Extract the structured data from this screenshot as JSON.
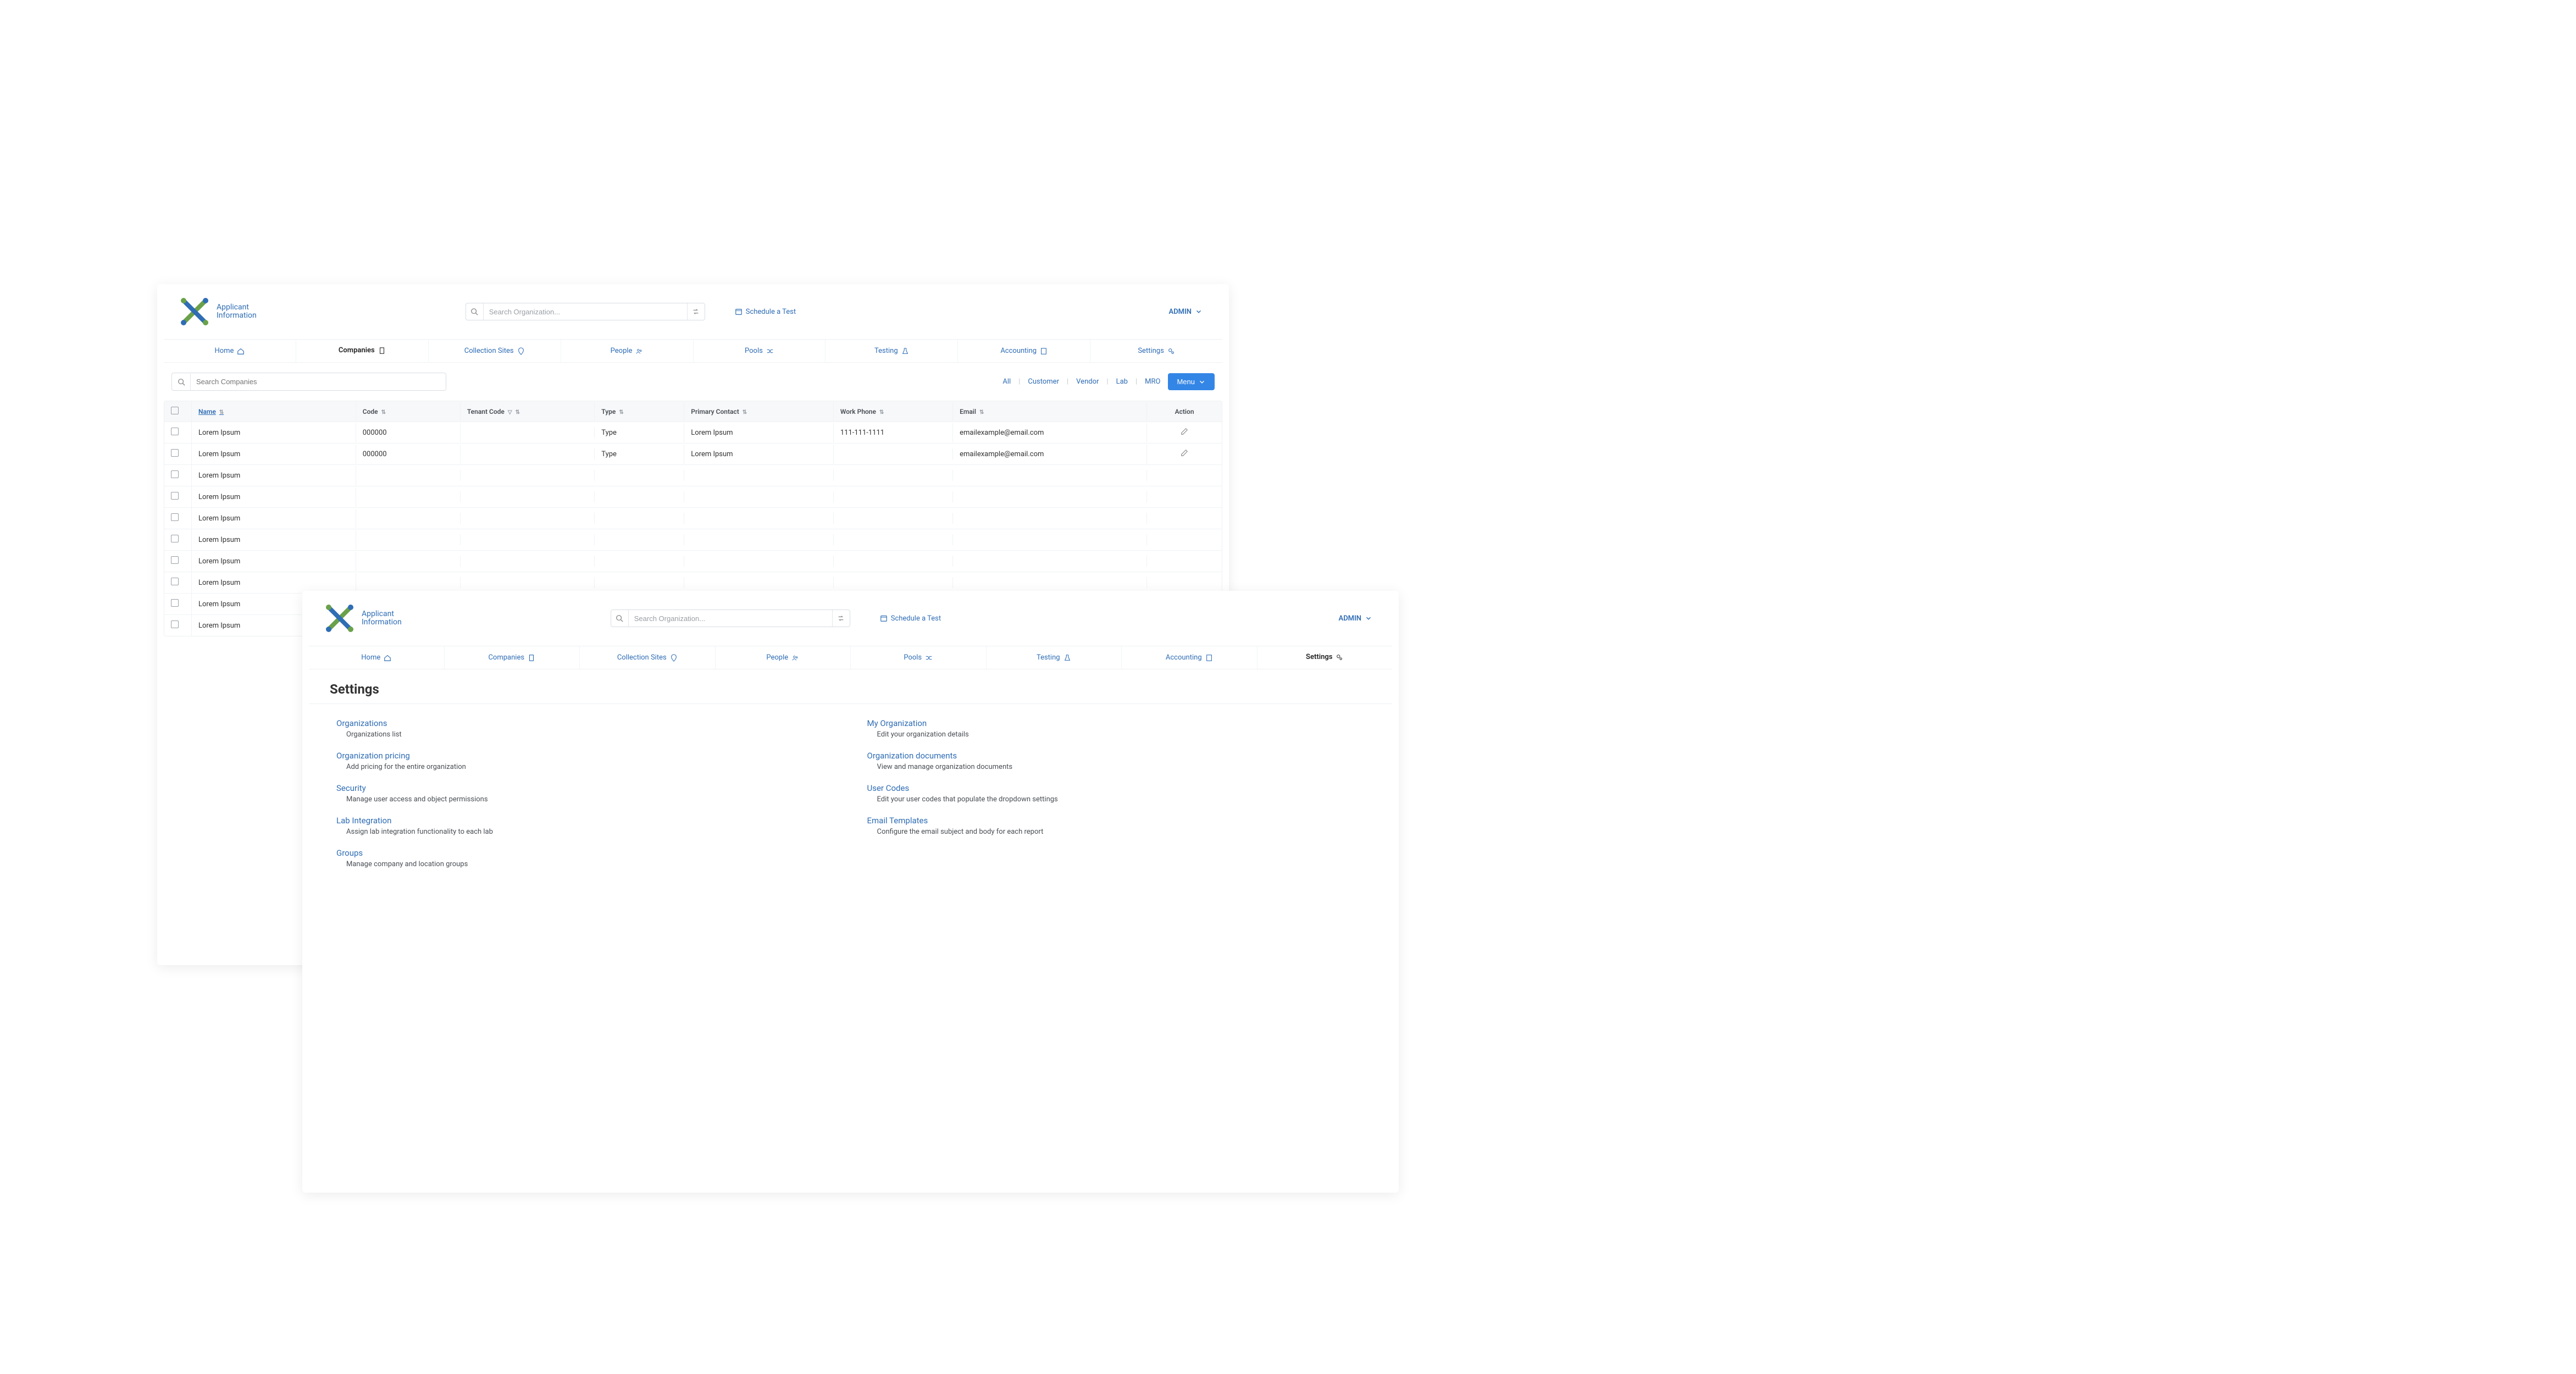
{
  "brand": {
    "line1": "Applicant",
    "line2": "Information"
  },
  "header": {
    "search_placeholder": "Search Organization...",
    "schedule_label": "Schedule a Test",
    "admin_label": "ADMIN"
  },
  "nav": {
    "home": "Home",
    "companies": "Companies",
    "collection_sites": "Collection Sites",
    "people": "People",
    "pools": "Pools",
    "testing": "Testing",
    "accounting": "Accounting",
    "settings": "Settings"
  },
  "companies_view": {
    "search_placeholder": "Search Companies",
    "filters": {
      "all": "All",
      "customer": "Customer",
      "vendor": "Vendor",
      "lab": "Lab",
      "mro": "MRO"
    },
    "menu_label": "Menu",
    "columns": {
      "name": "Name",
      "code": "Code",
      "tenant_code": "Tenant Code",
      "type": "Type",
      "primary_contact": "Primary Contact",
      "work_phone": "Work Phone",
      "email": "Email",
      "action": "Action"
    },
    "rows": [
      {
        "name": "Lorem Ipsum",
        "code": "000000",
        "tenant_code": "",
        "type": "Type",
        "primary_contact": "Lorem Ipsum",
        "work_phone": "111-111-1111",
        "email": "emailexample@email.com",
        "editable": true
      },
      {
        "name": "Lorem Ipsum",
        "code": "000000",
        "tenant_code": "",
        "type": "Type",
        "primary_contact": "Lorem Ipsum",
        "work_phone": "",
        "email": "emailexample@email.com",
        "editable": true
      },
      {
        "name": "Lorem Ipsum",
        "code": "",
        "tenant_code": "",
        "type": "",
        "primary_contact": "",
        "work_phone": "",
        "email": "",
        "editable": false
      },
      {
        "name": "Lorem Ipsum",
        "code": "",
        "tenant_code": "",
        "type": "",
        "primary_contact": "",
        "work_phone": "",
        "email": "",
        "editable": false
      },
      {
        "name": "Lorem Ipsum",
        "code": "",
        "tenant_code": "",
        "type": "",
        "primary_contact": "",
        "work_phone": "",
        "email": "",
        "editable": false
      },
      {
        "name": "Lorem Ipsum",
        "code": "",
        "tenant_code": "",
        "type": "",
        "primary_contact": "",
        "work_phone": "",
        "email": "",
        "editable": false
      },
      {
        "name": "Lorem Ipsum",
        "code": "",
        "tenant_code": "",
        "type": "",
        "primary_contact": "",
        "work_phone": "",
        "email": "",
        "editable": false
      },
      {
        "name": "Lorem Ipsum",
        "code": "",
        "tenant_code": "",
        "type": "",
        "primary_contact": "",
        "work_phone": "",
        "email": "",
        "editable": false
      },
      {
        "name": "Lorem Ipsum",
        "code": "",
        "tenant_code": "",
        "type": "",
        "primary_contact": "",
        "work_phone": "",
        "email": "",
        "editable": false
      },
      {
        "name": "Lorem Ipsum",
        "code": "",
        "tenant_code": "",
        "type": "",
        "primary_contact": "",
        "work_phone": "",
        "email": "",
        "editable": false
      }
    ]
  },
  "settings_view": {
    "title": "Settings",
    "left": [
      {
        "title": "Organizations",
        "desc": "Organizations list"
      },
      {
        "title": "Organization pricing",
        "desc": "Add pricing for the entire organization"
      },
      {
        "title": "Security",
        "desc": "Manage user access and object permissions"
      },
      {
        "title": "Lab Integration",
        "desc": "Assign lab integration functionality to each lab"
      },
      {
        "title": "Groups",
        "desc": "Manage company and location groups"
      }
    ],
    "right": [
      {
        "title": "My Organization",
        "desc": "Edit your organization details"
      },
      {
        "title": "Organization documents",
        "desc": "View and manage organization documents"
      },
      {
        "title": "User Codes",
        "desc": "Edit your user codes that populate the dropdown settings"
      },
      {
        "title": "Email Templates",
        "desc": "Configure the email subject and body for each report"
      }
    ]
  }
}
